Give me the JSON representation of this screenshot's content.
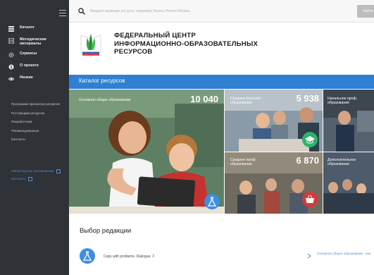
{
  "sidebar": {
    "nav": [
      {
        "label": "Каталог",
        "icon": "catalog-icon"
      },
      {
        "label": "Методические материалы",
        "icon": "documents-icon"
      },
      {
        "label": "Сервисы",
        "icon": "gear-icon"
      },
      {
        "label": "О проекте",
        "icon": "info-icon"
      },
      {
        "label": "Низкие",
        "icon": "eye-icon"
      }
    ],
    "links": [
      "Программа просмотра ресурсов",
      "Поставщики ресурсов",
      "Разработчики",
      "Рекомендованные",
      "Контакты"
    ],
    "bottom_links": [
      "Министерство просвещения",
      "Контакты"
    ]
  },
  "topbar": {
    "search_placeholder": "Введите название ресурса, например Запись Регион Москва",
    "search_button": "Найти"
  },
  "header": {
    "title_line1": "ФЕДЕРАЛЬНЫЙ ЦЕНТР",
    "title_line2": "ИНФОРМАЦИОННО-ОБРАЗОВАТЕЛЬНЫХ",
    "title_line3": "РЕСУРСОВ"
  },
  "section": {
    "title": "Каталог ресурсов"
  },
  "tiles": [
    {
      "label": "Основное общее образование",
      "count": "10 040"
    },
    {
      "label": "Среднее (полное) образование",
      "count": "5 938"
    },
    {
      "label": "Начальное проф. образование",
      "count": ""
    },
    {
      "label": "Среднее проф. образование",
      "count": "6 870"
    },
    {
      "label": "Дополнительное образование",
      "count": ""
    }
  ],
  "editors_choice": {
    "title": "Выбор редакции",
    "item": "Copy with problems. Dialogue. 2",
    "link": "Основное общее образование · изо"
  },
  "colors": {
    "sidebar_bg": "#2f3236",
    "accent_blue": "#2f7fd3",
    "green_fab": "#2fb36b",
    "red_fab": "#d8383b",
    "blue_fab": "#3d8ee0"
  }
}
